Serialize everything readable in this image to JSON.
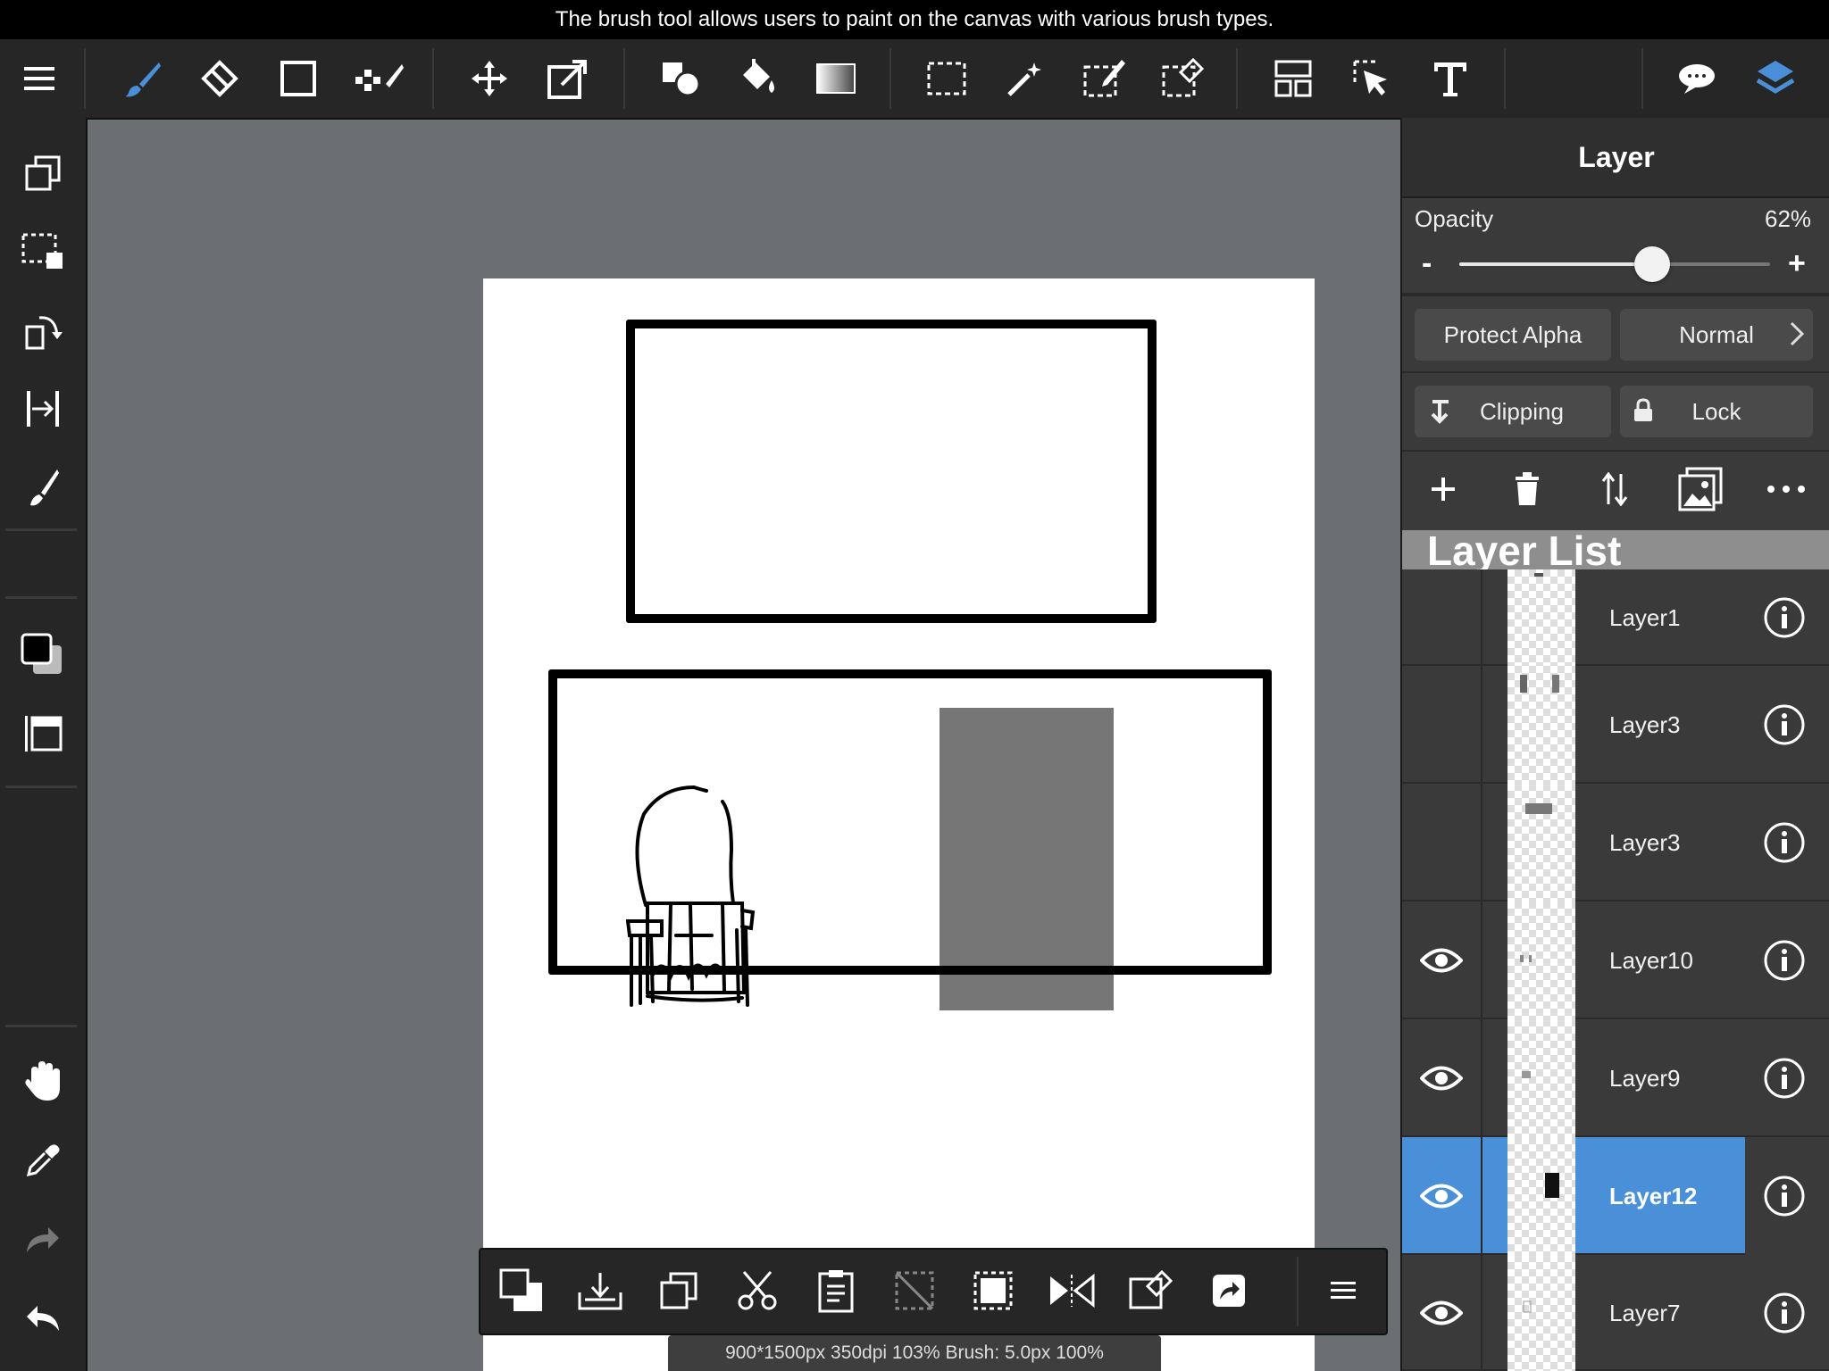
{
  "tooltip": "The brush tool allows users to paint on the canvas with various brush types.",
  "toolbar": {
    "tools": [
      "menu-icon",
      "brush-icon",
      "eraser-icon",
      "rectangle-icon",
      "dot-pen-icon",
      "move-icon",
      "transform-icon",
      "shape-fill-icon",
      "bucket-icon",
      "gradient-icon",
      "selection-rect-icon",
      "magic-wand-icon",
      "selection-pen-icon",
      "selection-eraser-icon",
      "frame-divider-icon",
      "operation-icon",
      "text-icon",
      "speech-bubble-icon",
      "layers-icon"
    ],
    "active": "brush-icon",
    "accent": "#4a90d9"
  },
  "sidebar": {
    "tools": [
      "copy-layer-icon",
      "select-layer-icon",
      "rotate-icon",
      "snap-icon",
      "brush-size-icon",
      "color-swatch-icon",
      "layer-preview-icon",
      "hand-icon",
      "eyedropper-icon",
      "redo-icon",
      "undo-icon"
    ]
  },
  "status": "900*1500px 350dpi 103% Brush: 5.0px 100%",
  "panel": {
    "title": "Layer",
    "opacity_label": "Opacity",
    "opacity_value": "62%",
    "opacity_fraction": 0.62,
    "minus": "-",
    "plus": "+",
    "protect_alpha": "Protect Alpha",
    "blend_mode": "Normal",
    "clipping": "Clipping",
    "lock": "Lock",
    "list_header": "Layer List"
  },
  "layers": [
    {
      "name": "Layer1",
      "visible": false,
      "selected": false
    },
    {
      "name": "Layer3",
      "visible": false,
      "selected": false
    },
    {
      "name": "Layer3",
      "visible": false,
      "selected": false
    },
    {
      "name": "Layer10",
      "visible": true,
      "selected": false
    },
    {
      "name": "Layer9",
      "visible": true,
      "selected": false
    },
    {
      "name": "Layer12",
      "visible": true,
      "selected": true
    },
    {
      "name": "Layer7",
      "visible": true,
      "selected": false
    }
  ],
  "bottombar": {
    "tools": [
      "color-swap-icon",
      "import-icon",
      "duplicate-icon",
      "cut-icon",
      "paste-icon",
      "deselect-icon",
      "select-all-icon",
      "flip-icon",
      "edit-selection-icon",
      "export-icon",
      "more-menu-icon"
    ]
  }
}
